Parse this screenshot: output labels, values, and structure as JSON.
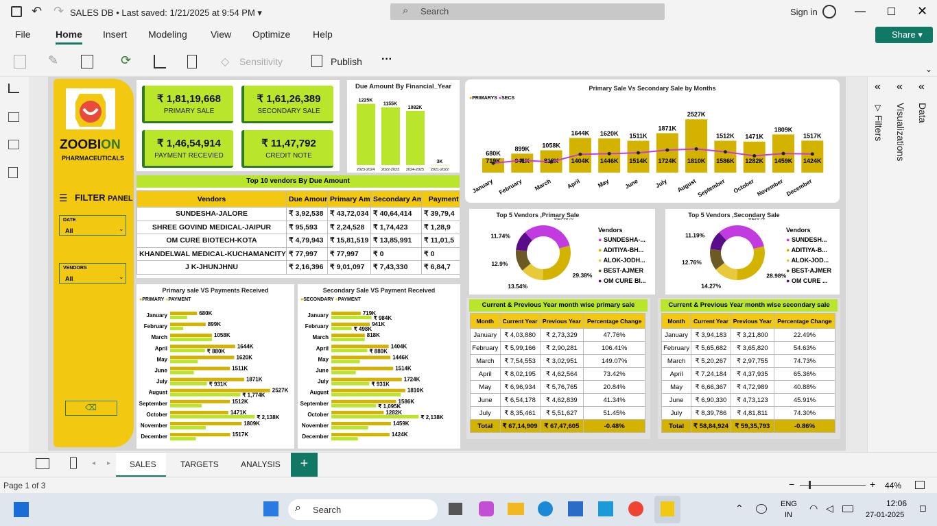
{
  "app": {
    "file_title": "SALES DB",
    "saved_status": "• Last saved: 1/21/2025 at 9:54 PM",
    "search_placeholder": "Search",
    "sign_in": "Sign in",
    "share": "Share"
  },
  "menu": [
    "File",
    "Home",
    "Insert",
    "Modeling",
    "View",
    "Optimize",
    "Help"
  ],
  "ribbon": {
    "sensitivity": "Sensitivity",
    "publish": "Publish",
    "more": "···"
  },
  "brand": {
    "name_main": "ZOOBI",
    "name_accent": "ON",
    "sub": "PHARMACEUTICALS",
    "filter_title": "FILTER",
    "filter_sub": "PANEL",
    "date_label": "DATE",
    "date_value": "All",
    "vendor_label": "VENDORS",
    "vendor_value": "All"
  },
  "kpis": [
    {
      "value": "₹ 1,81,19,668",
      "label": "PRIMARY SALE"
    },
    {
      "value": "₹ 1,61,26,389",
      "label": "SECONDARY SALE"
    },
    {
      "value": "₹ 1,46,54,914",
      "label": "PAYMENT RECEVIED"
    },
    {
      "value": "₹ 11,47,792",
      "label": "CREDIT NOTE"
    }
  ],
  "due_chart": {
    "title": "Due Amount By Financial_Year",
    "categories": [
      "2023-2024",
      "2022-2023",
      "2024-2025",
      "2021-2022"
    ],
    "values": [
      1225,
      1155,
      1082,
      3
    ],
    "labels": [
      "1225K",
      "1155K",
      "1082K",
      "3K"
    ]
  },
  "primary_secondary": {
    "title": "Primary Sale Vs Secondary Sale by Months",
    "legend": [
      "PRIMARYS",
      "SECS"
    ],
    "months": [
      "January",
      "February",
      "March",
      "April",
      "May",
      "June",
      "July",
      "August",
      "September",
      "October",
      "November",
      "December"
    ],
    "primary": [
      680,
      899,
      1058,
      1644,
      1620,
      1511,
      1871,
      2527,
      1512,
      1471,
      1809,
      1517
    ],
    "secondary": [
      719,
      941,
      818,
      1404,
      1446,
      1514,
      1724,
      1810,
      1586,
      1282,
      1459,
      1424
    ]
  },
  "top_vendors": {
    "title": "Top 10 vendors By Due Amount",
    "headers": [
      "Vendors",
      "Due Amount",
      "Primary Amt",
      "Secondary Amt",
      "Payment D"
    ],
    "rows": [
      [
        "SUNDESHA-JALORE",
        "₹ 3,92,538",
        "₹ 43,72,034",
        "₹ 40,64,414",
        "₹ 39,79,4"
      ],
      [
        "SHREE GOVIND MEDICAL-JAIPUR",
        "₹ 95,593",
        "₹ 2,24,528",
        "₹ 1,74,423",
        "₹ 1,28,9"
      ],
      [
        "OM CURE BIOTECH-KOTA",
        "₹ 4,79,943",
        "₹ 15,81,519",
        "₹ 13,85,991",
        "₹ 11,01,5"
      ],
      [
        "KHANDELWAL MEDICAL-KUCHAMANCITY",
        "₹ 77,997",
        "₹ 77,997",
        "₹ 0",
        "₹ 0"
      ],
      [
        "J K-JHUNJHNU",
        "₹ 2,16,396",
        "₹ 9,01,097",
        "₹ 7,43,330",
        "₹ 6,84,7"
      ]
    ]
  },
  "donut_primary": {
    "title": "Top 5 Vendors ,Primary Sale",
    "legend_title": "Vendors",
    "legend": [
      "SUNDESHA-...",
      "ADITIYA-BH...",
      "ALOK-JODH...",
      "BEST-AJMER",
      "OM CURE BI..."
    ],
    "values": [
      32.45,
      29.38,
      13.54,
      12.9,
      11.74
    ],
    "labels": [
      "32.45%",
      "29.38%",
      "13.54%",
      "12.9%",
      "11.74%"
    ],
    "colors": [
      "#c23be0",
      "#d4b300",
      "#e8c93a",
      "#6b5a24",
      "#5a0d8a"
    ]
  },
  "donut_secondary": {
    "title": "Top 5 Vendors ,Secondary Sale",
    "legend_title": "Vendors",
    "legend": [
      "SUNDESH...",
      "ADITIYA-B...",
      "ALOK-JOD...",
      "BEST-AJMER",
      "OM CURE ..."
    ],
    "values": [
      32.8,
      28.98,
      14.27,
      12.76,
      11.19
    ],
    "labels": [
      "32.8%",
      "28.98%",
      "14.27%",
      "12.76%",
      "11.19%"
    ],
    "colors": [
      "#c23be0",
      "#d4b300",
      "#e8c93a",
      "#6b5a24",
      "#5a0d8a"
    ]
  },
  "bars_primary_payment": {
    "title": "Primary sale VS Payments Received",
    "legend": [
      "PRIMARY",
      "PAYMENT"
    ],
    "months": [
      "January",
      "February",
      "March",
      "April",
      "May",
      "June",
      "July",
      "August",
      "September",
      "October",
      "November",
      "December"
    ],
    "a_labels": [
      "680K",
      "899K",
      "1058K",
      "1644K",
      "1620K",
      "1511K",
      "1871K",
      "2527K",
      "1512K",
      "1471K",
      "1809K",
      "1517K"
    ],
    "a": [
      680,
      899,
      1058,
      1644,
      1620,
      1511,
      1871,
      2527,
      1512,
      1471,
      1809,
      1517
    ],
    "b": [
      430,
      330,
      1058,
      880,
      700,
      600,
      931,
      1774,
      800,
      2138,
      900,
      650
    ],
    "b_labels": [
      "",
      "",
      "",
      "₹ 880K",
      "",
      "",
      "₹ 931K",
      "₹ 1,774K",
      "",
      "₹ 2,138K",
      "",
      ""
    ]
  },
  "bars_secondary_payment": {
    "title": "Secondary Sale VS Payment Received",
    "legend": [
      "SECONDARY",
      "PAYMENT"
    ],
    "months": [
      "January",
      "February",
      "March",
      "April",
      "May",
      "June",
      "July",
      "August",
      "September",
      "October",
      "November",
      "December"
    ],
    "a_labels": [
      "719K",
      "941K",
      "818K",
      "1404K",
      "1446K",
      "1514K",
      "1724K",
      "1810K",
      "1586K",
      "1282K",
      "1459K",
      "1424K"
    ],
    "a": [
      719,
      941,
      818,
      1404,
      1446,
      1514,
      1724,
      1810,
      1586,
      1282,
      1459,
      1424
    ],
    "b": [
      984,
      498,
      818,
      880,
      700,
      600,
      931,
      1700,
      1095,
      2138,
      900,
      650
    ],
    "b_labels": [
      "₹ 984K",
      "₹ 498K",
      "",
      "₹ 880K",
      "",
      "",
      "₹ 931K",
      "",
      "₹ 1,095K",
      "₹ 2,138K",
      "",
      ""
    ]
  },
  "month_primary": {
    "title": "Current & Previous Year month wise primary sale",
    "headers": [
      "Month",
      "Current Year",
      "Previous Year",
      "Percentage Change"
    ],
    "rows": [
      [
        "January",
        "₹ 4,03,880",
        "₹ 2,73,329",
        "47.76%"
      ],
      [
        "February",
        "₹ 5,99,166",
        "₹ 2,90,281",
        "106.41%"
      ],
      [
        "March",
        "₹ 7,54,553",
        "₹ 3,02,951",
        "149.07%"
      ],
      [
        "April",
        "₹ 8,02,195",
        "₹ 4,62,564",
        "73.42%"
      ],
      [
        "May",
        "₹ 6,96,934",
        "₹ 5,76,765",
        "20.84%"
      ],
      [
        "June",
        "₹ 6,54,178",
        "₹ 4,62,839",
        "41.34%"
      ],
      [
        "July",
        "₹ 8,35,461",
        "₹ 5,51,627",
        "51.45%"
      ]
    ],
    "total": [
      "Total",
      "₹ 67,14,909",
      "₹ 67,47,605",
      "-0.48%"
    ]
  },
  "month_secondary": {
    "title": "Current & Previous Year month wise secondary sale",
    "headers": [
      "Month",
      "Current Year",
      "Previous Year",
      "Percentage Change"
    ],
    "rows": [
      [
        "January",
        "₹ 3,94,183",
        "₹ 3,21,800",
        "22.49%"
      ],
      [
        "February",
        "₹ 5,65,682",
        "₹ 3,65,820",
        "54.63%"
      ],
      [
        "March",
        "₹ 5,20,267",
        "₹ 2,97,755",
        "74.73%"
      ],
      [
        "April",
        "₹ 7,24,184",
        "₹ 4,37,935",
        "65.36%"
      ],
      [
        "May",
        "₹ 6,66,367",
        "₹ 4,72,989",
        "40.88%"
      ],
      [
        "June",
        "₹ 6,90,330",
        "₹ 4,73,123",
        "45.91%"
      ],
      [
        "July",
        "₹ 8,39,786",
        "₹ 4,81,811",
        "74.30%"
      ]
    ],
    "total": [
      "Total",
      "₹ 58,84,924",
      "₹ 59,35,793",
      "-0.86%"
    ]
  },
  "panes": {
    "filters": "Filters",
    "visualizations": "Visualizations",
    "data": "Data"
  },
  "page_tabs": [
    "SALES",
    "TARGETS",
    "ANALYSIS"
  ],
  "status": {
    "page": "Page 1 of 3",
    "zoom": "44%"
  },
  "taskbar": {
    "search": "Search",
    "lang1": "ENG",
    "lang2": "IN",
    "time": "12:06",
    "date": "27-01-2025"
  },
  "colors": {
    "yellow": "#f2c811",
    "green": "#b9e62b",
    "gold": "#d4b300",
    "magenta": "#c23be0"
  }
}
